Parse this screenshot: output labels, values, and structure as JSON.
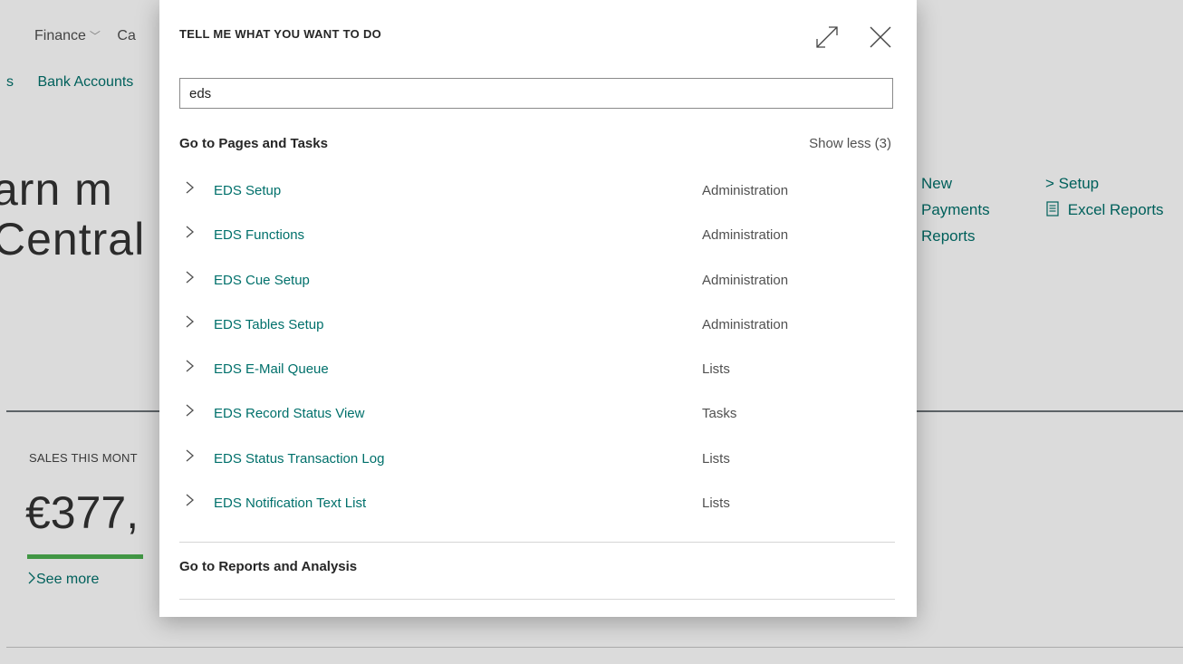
{
  "background": {
    "nav": {
      "item1": "Finance",
      "item2_partial": "Ca"
    },
    "subnav": {
      "item1_partial": "s",
      "item2_partial": "Bank Accounts"
    },
    "hero": {
      "line1_partial": "arn m",
      "line2_partial": "Central"
    },
    "actions": {
      "col1": [
        "New",
        "Payments",
        "Reports"
      ],
      "col2": [
        {
          "prefix": ">",
          "label": "Setup"
        },
        {
          "prefix": "",
          "label": "Excel Reports"
        }
      ]
    },
    "sales": {
      "label_partial": "SALES THIS MONT",
      "value_partial": "€377,",
      "see_more": "See more",
      "bar_color": "#4caf50"
    }
  },
  "dialog": {
    "title": "TELL ME WHAT YOU WANT TO DO",
    "expand_icon": "expand-icon",
    "close_icon": "close-icon",
    "search": {
      "value": "eds"
    },
    "pages_section": {
      "heading": "Go to Pages and Tasks",
      "show_less": "Show less (3)",
      "items": [
        {
          "name": "EDS Setup",
          "category": "Administration"
        },
        {
          "name": "EDS Functions",
          "category": "Administration"
        },
        {
          "name": "EDS Cue Setup",
          "category": "Administration"
        },
        {
          "name": "EDS Tables Setup",
          "category": "Administration"
        },
        {
          "name": "EDS E-Mail Queue",
          "category": "Lists"
        },
        {
          "name": "EDS Record Status View",
          "category": "Tasks"
        },
        {
          "name": "EDS Status Transaction Log",
          "category": "Lists"
        },
        {
          "name": "EDS Notification Text List",
          "category": "Lists"
        }
      ]
    },
    "reports_section": {
      "heading": "Go to Reports and Analysis"
    }
  },
  "colors": {
    "accent": "#00706b",
    "text": "#212121",
    "muted": "#505050"
  }
}
